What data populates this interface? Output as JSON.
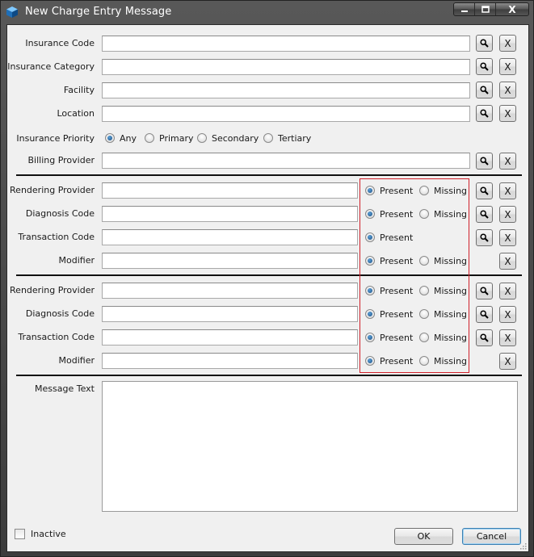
{
  "window": {
    "title": "New Charge Entry Message"
  },
  "caption": {
    "close": "X"
  },
  "top_fields": [
    {
      "label": "Insurance Code",
      "value": ""
    },
    {
      "label": "Insurance Category",
      "value": ""
    },
    {
      "label": "Facility",
      "value": ""
    },
    {
      "label": "Location",
      "value": ""
    }
  ],
  "insurance_priority": {
    "label": "Insurance Priority",
    "options": [
      "Any",
      "Primary",
      "Secondary",
      "Tertiary"
    ],
    "selected": "Any"
  },
  "billing_provider": {
    "label": "Billing Provider",
    "value": ""
  },
  "group1": [
    {
      "label": "Rendering Provider",
      "present": "Present",
      "missing": "Missing"
    },
    {
      "label": "Diagnosis Code",
      "present": "Present",
      "missing": "Missing"
    },
    {
      "label": "Transaction Code",
      "present": "Present"
    },
    {
      "label": "Modifier",
      "present": "Present",
      "missing": "Missing"
    }
  ],
  "group2": [
    {
      "label": "Rendering Provider",
      "present": "Present",
      "missing": "Missing"
    },
    {
      "label": "Diagnosis Code",
      "present": "Present",
      "missing": "Missing"
    },
    {
      "label": "Transaction Code",
      "present": "Present",
      "missing": "Missing"
    },
    {
      "label": "Modifier",
      "present": "Present",
      "missing": "Missing"
    }
  ],
  "clear_label": "X",
  "message_text": {
    "label": "Message Text",
    "value": ""
  },
  "inactive": {
    "label": "Inactive",
    "checked": false
  },
  "buttons": {
    "ok": "OK",
    "cancel": "Cancel"
  },
  "colors": {
    "highlight_box": "#d0202a",
    "titlebar": "#4a4a4a"
  }
}
